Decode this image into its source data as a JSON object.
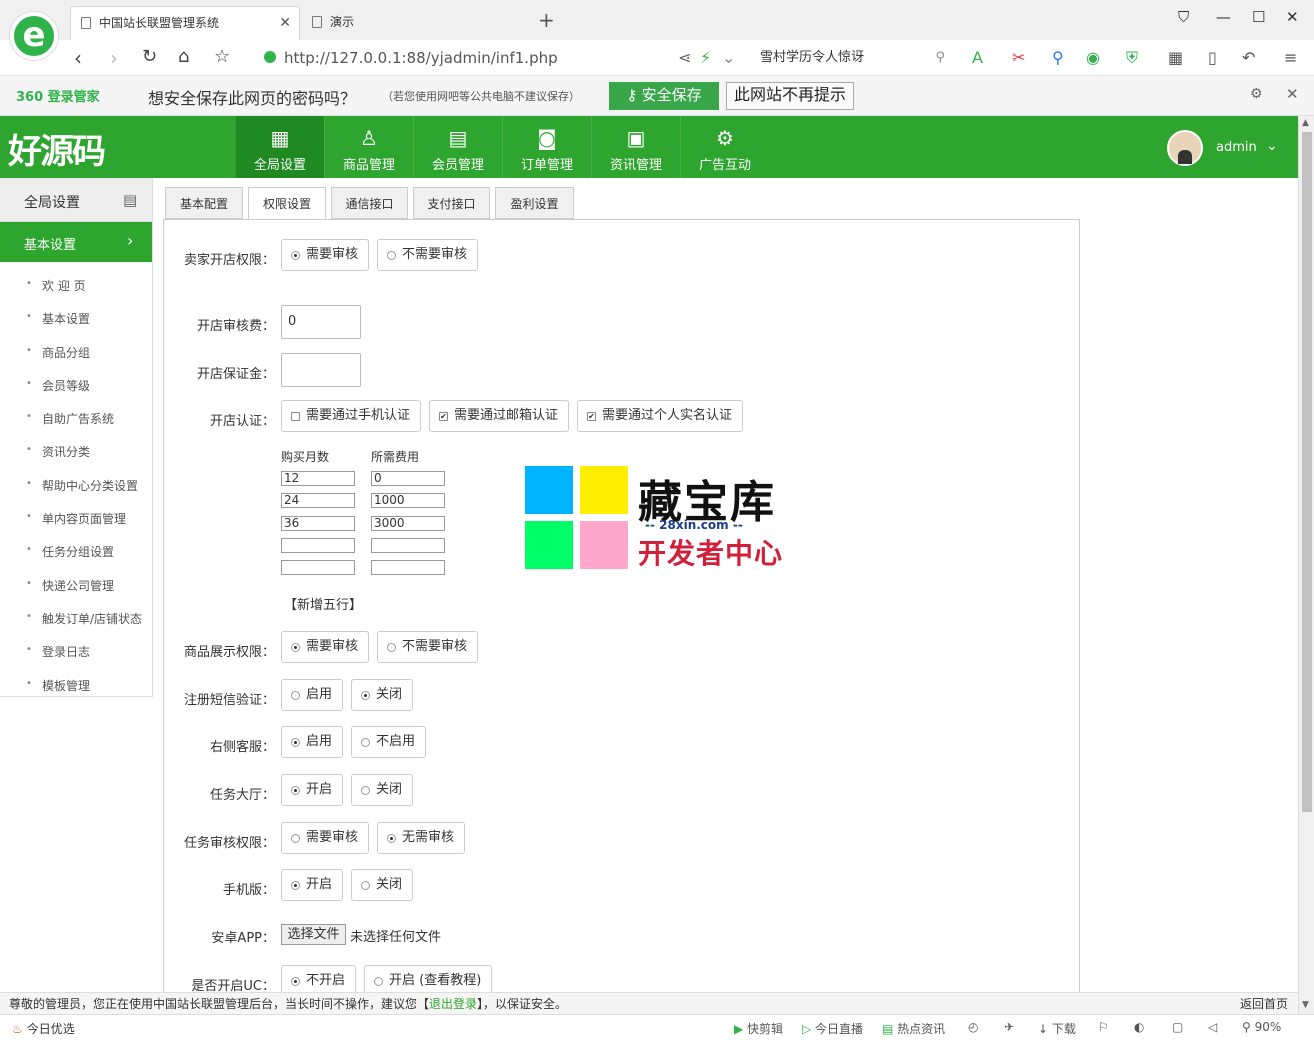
{
  "browser": {
    "tabs": [
      {
        "title": "中国站长联盟管理系统",
        "active": true
      },
      {
        "title": "演示",
        "active": false
      }
    ],
    "url": "http://127.0.0.1:88/yjadmin/inf1.php",
    "search_text": "雪村学历令人惊讶",
    "password_bar": {
      "brand": "360 登录管家",
      "message": "想安全保存此网页的密码吗？",
      "note": "（若您使用网吧等公共电脑不建议保存）",
      "save_label": "安全保存",
      "never_label": "此网站不再提示"
    }
  },
  "header": {
    "logo": "好源码",
    "nav": [
      {
        "label": "全局设置",
        "icon": "grid-icon",
        "active": true
      },
      {
        "label": "商品管理",
        "icon": "user-icon",
        "active": false
      },
      {
        "label": "会员管理",
        "icon": "book-icon",
        "active": false
      },
      {
        "label": "订单管理",
        "icon": "camera-icon",
        "active": false
      },
      {
        "label": "资讯管理",
        "icon": "calendar-icon",
        "active": false
      },
      {
        "label": "广告互动",
        "icon": "gear-icon",
        "active": false
      }
    ],
    "user": "admin"
  },
  "sidebar": {
    "title": "全局设置",
    "active_item": "基本设置",
    "items": [
      "欢 迎 页",
      "基本设置",
      "商品分组",
      "会员等级",
      "自助广告系统",
      "资讯分类",
      "帮助中心分类设置",
      "单内容页面管理",
      "任务分组设置",
      "快递公司管理",
      "触发订单/店铺状态",
      "登录日志",
      "模板管理"
    ]
  },
  "content_tabs": [
    "基本配置",
    "权限设置",
    "通信接口",
    "支付接口",
    "盈利设置"
  ],
  "form": {
    "seller_open": {
      "label": "卖家开店权限：",
      "options": [
        "需要审核",
        "不需要审核"
      ],
      "selected": 0
    },
    "audit_fee": {
      "label": "开店审核费：",
      "value": "0"
    },
    "deposit": {
      "label": "开店保证金：",
      "value": ""
    },
    "certification": {
      "label": "开店认证：",
      "options": [
        {
          "label": "需要通过手机认证",
          "checked": false
        },
        {
          "label": "需要通过邮箱认证",
          "checked": true
        },
        {
          "label": "需要通过个人实名认证",
          "checked": true
        }
      ]
    },
    "fee_table": {
      "headers": [
        "购买月数",
        "所需费用"
      ],
      "rows": [
        [
          "12",
          "0"
        ],
        [
          "24",
          "1000"
        ],
        [
          "36",
          "3000"
        ],
        [
          "",
          ""
        ],
        [
          "",
          ""
        ]
      ],
      "add_label": "【新增五行】"
    },
    "product_display": {
      "label": "商品展示权限：",
      "options": [
        "需要审核",
        "不需要审核"
      ],
      "selected": 0
    },
    "sms_verify": {
      "label": "注册短信验证：",
      "options": [
        "启用",
        "关闭"
      ],
      "selected": 1
    },
    "side_service": {
      "label": "右侧客服：",
      "options": [
        "启用",
        "不启用"
      ],
      "selected": 0
    },
    "task_hall": {
      "label": "任务大厅：",
      "options": [
        "开启",
        "关闭"
      ],
      "selected": 0
    },
    "task_audit": {
      "label": "任务审核权限：",
      "options": [
        "需要审核",
        "无需审核"
      ],
      "selected": 1
    },
    "mobile": {
      "label": "手机版：",
      "options": [
        "开启",
        "关闭"
      ],
      "selected": 0
    },
    "android_app": {
      "label": "安卓APP：",
      "button": "选择文件",
      "status": "未选择任何文件"
    },
    "uc": {
      "label": "是否开启UC：",
      "options": [
        "不开启",
        "开启 (查看教程)"
      ],
      "selected": 0
    }
  },
  "watermark": {
    "title": "藏宝库",
    "url": "-- 28xin.com --",
    "subtitle": "开发者中心",
    "colors": [
      "#00b4ff",
      "#ffee00",
      "#00ff66",
      "#ffa8cc"
    ]
  },
  "footer": {
    "message_pre": "尊敬的管理员，您正在使用中国站长联盟管理后台，当长时间不操作，建议您【",
    "logout": "退出登录",
    "message_post": "】，以保证安全。",
    "home": "返回首页"
  },
  "statusbar": {
    "left": "今日优选",
    "items": [
      "快剪辑",
      "今日直播",
      "热点资讯",
      "下载",
      "90%"
    ]
  },
  "colors": {
    "brand_green": "#2ea52f",
    "active_green": "#1f8a22"
  }
}
